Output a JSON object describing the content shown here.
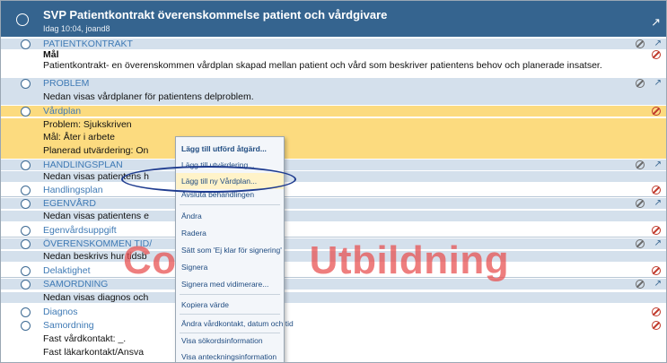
{
  "document": {
    "title": "SVP Patientkontrakt överenskommelse patient och vårdgivare",
    "meta": "Idag 10:04, joand8"
  },
  "rows": [
    {
      "id": "patientkontrakt",
      "label": "PATIENTKONTRAKT"
    },
    {
      "id": "mal_heading",
      "text": "Mål"
    },
    {
      "id": "mal_text",
      "text": "Patientkontrakt- en överenskommen vårdplan skapad mellan patient och vård som beskriver patientens behov och planerade insatser."
    },
    {
      "id": "problem",
      "label": "PROBLEM"
    },
    {
      "id": "problem_text",
      "text": "Nedan visas vårdplaner för patientens delproblem."
    },
    {
      "id": "vardplan",
      "label": "Vårdplan"
    },
    {
      "id": "vardplan_problem",
      "text": "Problem: Sjukskriven"
    },
    {
      "id": "vardplan_mal",
      "text": "Mål: Åter i arbete"
    },
    {
      "id": "vardplan_utv",
      "text": "Planerad utvärdering: On"
    },
    {
      "id": "handlingsplan",
      "label": "HANDLINGSPLAN"
    },
    {
      "id": "handlingsplan_text",
      "text": "Nedan visas patientens h"
    },
    {
      "id": "handlingsplan_item",
      "label": "Handlingsplan"
    },
    {
      "id": "egenvard",
      "label": "EGENVÅRD"
    },
    {
      "id": "egenvard_text",
      "text": "Nedan visas patientens e"
    },
    {
      "id": "egenvard_item",
      "label": "Egenvårdsuppgift"
    },
    {
      "id": "overenskommen",
      "label": "ÖVERENSKOMMEN TID/"
    },
    {
      "id": "overenskommen_text",
      "text": "Nedan beskrivs hur tidsb"
    },
    {
      "id": "delaktighet",
      "label": "Delaktighet"
    },
    {
      "id": "samordning",
      "label": "SAMORDNING"
    },
    {
      "id": "samordning_text",
      "text": "Nedan visas diagnos och"
    },
    {
      "id": "diagnos",
      "label": "Diagnos"
    },
    {
      "id": "samordning_item",
      "label": "Samordning"
    },
    {
      "id": "fast_vardkontakt",
      "text": "Fast vårdkontakt: _."
    },
    {
      "id": "fast_lakarkontakt",
      "text": "Fast läkarkontakt/Ansva"
    }
  ],
  "context_menu": [
    "Lägg till utförd åtgärd...",
    "Lägg till utvärdering...",
    "Lägg till ny Vårdplan...",
    "Avsluta behandlingen",
    "Ändra",
    "Radera",
    "Sätt som 'Ej klar för signering'",
    "Signera",
    "Signera med vidimerare...",
    "Kopiera värde",
    "Ändra vårdkontakt, datum och tid",
    "Visa sökordsinformation",
    "Visa anteckningsinformation"
  ],
  "watermark": {
    "left": "Co",
    "right": "Utbildning"
  },
  "colors": {
    "header": "#35648f",
    "section_bg": "#d4e0ec",
    "highlight_row": "#fcdb7f",
    "label": "#3f7ab5",
    "annotation_oval": "#1f3c8f",
    "watermark": "#e74c4c"
  }
}
